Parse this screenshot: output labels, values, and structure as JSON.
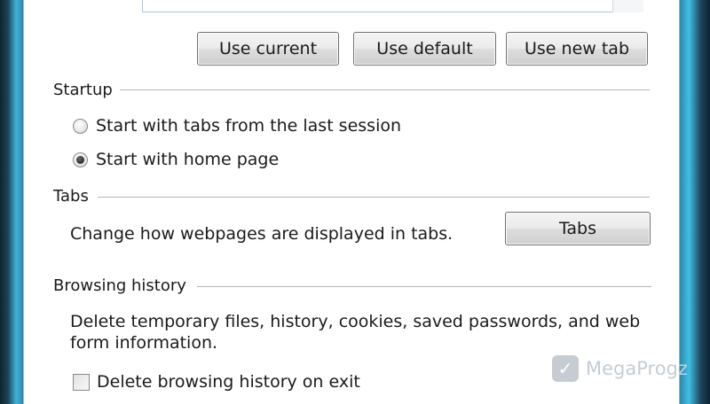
{
  "home": {
    "buttons": {
      "use_current": "Use current",
      "use_default": "Use default",
      "use_new_tab": "Use new tab"
    }
  },
  "startup": {
    "heading": "Startup",
    "options": [
      {
        "label": "Start with tabs from the last session",
        "selected": false
      },
      {
        "label": "Start with home page",
        "selected": true
      }
    ]
  },
  "tabs": {
    "heading": "Tabs",
    "description": "Change how webpages are displayed in tabs.",
    "button": "Tabs"
  },
  "browsing_history": {
    "heading": "Browsing history",
    "description_line1": "Delete temporary files, history, cookies, saved passwords, and web",
    "description_line2": "form information.",
    "checkbox_label": "Delete browsing history on exit",
    "checkbox_checked": false
  },
  "watermark": {
    "text": "MegaProgz"
  },
  "colors": {
    "frame_accent": "#3fb3d6",
    "panel_bg": "#ffffff",
    "textbox_border": "#a9c7e4"
  }
}
